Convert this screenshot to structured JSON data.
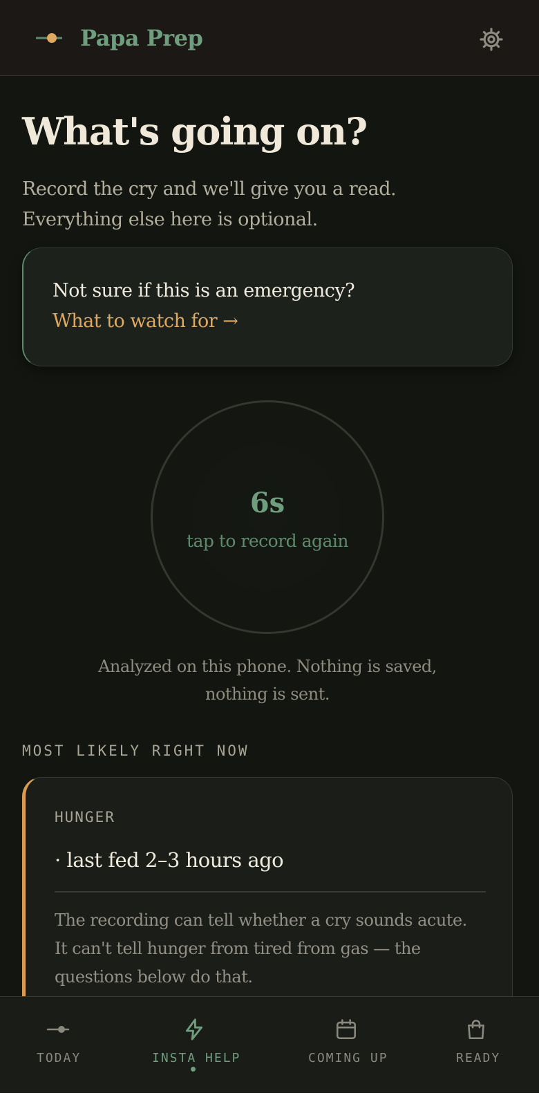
{
  "header": {
    "app_title": "Papa Prep",
    "logo_icon": "timeline-dot-icon",
    "settings_icon": "gear-icon"
  },
  "main": {
    "title": "What's going on?",
    "subtitle_line1": "Record the cry and we'll give you a read.",
    "subtitle_line2": "Everything else here is optional."
  },
  "emergency_card": {
    "question": "Not sure if this is an emergency?",
    "link": "What to watch for →"
  },
  "recorder": {
    "seconds": "6s",
    "hint": "tap to record again",
    "privacy_line1": "Analyzed on this phone. Nothing is saved,",
    "privacy_line2": "nothing is sent."
  },
  "likely": {
    "section_label": "MOST LIKELY RIGHT NOW",
    "tag": "HUNGER",
    "detail": "· last fed 2–3 hours ago",
    "body_line1": "The recording can tell whether a cry sounds acute.",
    "body_line2": "It can't tell hunger from tired from gas — the",
    "body_line3": "questions below do that."
  },
  "nav": {
    "items": [
      {
        "label": "TODAY",
        "icon": "timeline-dot-icon",
        "active": false
      },
      {
        "label": "INSTA HELP",
        "icon": "lightning-icon",
        "active": true
      },
      {
        "label": "COMING UP",
        "icon": "calendar-icon",
        "active": false
      },
      {
        "label": "READY",
        "icon": "bag-icon",
        "active": false
      }
    ]
  },
  "colors": {
    "accent_green": "#6f9e7e",
    "accent_amber": "#e0a962",
    "background": "#121510"
  }
}
